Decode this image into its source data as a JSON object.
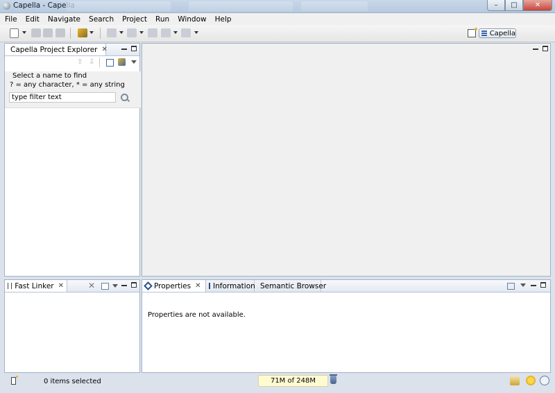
{
  "window": {
    "title": "Capella - Capella",
    "controls": {
      "minimize": "–",
      "maximize": "□",
      "close": "✕"
    }
  },
  "menubar": {
    "items": [
      "File",
      "Edit",
      "Navigate",
      "Search",
      "Project",
      "Run",
      "Window",
      "Help"
    ]
  },
  "toolbar": {
    "perspective_label": "Capella",
    "icons": [
      "new-icon",
      "save-icon",
      "save-all-icon",
      "print-icon",
      "run-tool-icon",
      "next-annotation-icon",
      "prev-annotation-icon",
      "last-edit-icon",
      "back-icon",
      "forward-icon",
      "open-perspective-icon"
    ]
  },
  "explorer": {
    "tab_label": "Capella Project Explorer",
    "filter_hint_1": "Select a name to find",
    "filter_hint_2": "? = any character, * = any string",
    "filter_placeholder": "type filter text"
  },
  "fast_linker": {
    "tab_label": "Fast Linker"
  },
  "bottom_panel": {
    "tabs": [
      "Properties",
      "Information",
      "Semantic Browser"
    ],
    "message": "Properties are not available."
  },
  "statusbar": {
    "selection": "0 items selected",
    "heap": "71M of 248M"
  },
  "colors": {
    "window_bg": "#dbe2ec",
    "panel_border": "#a3b2c6",
    "heap_bg": "#fffbd1"
  }
}
